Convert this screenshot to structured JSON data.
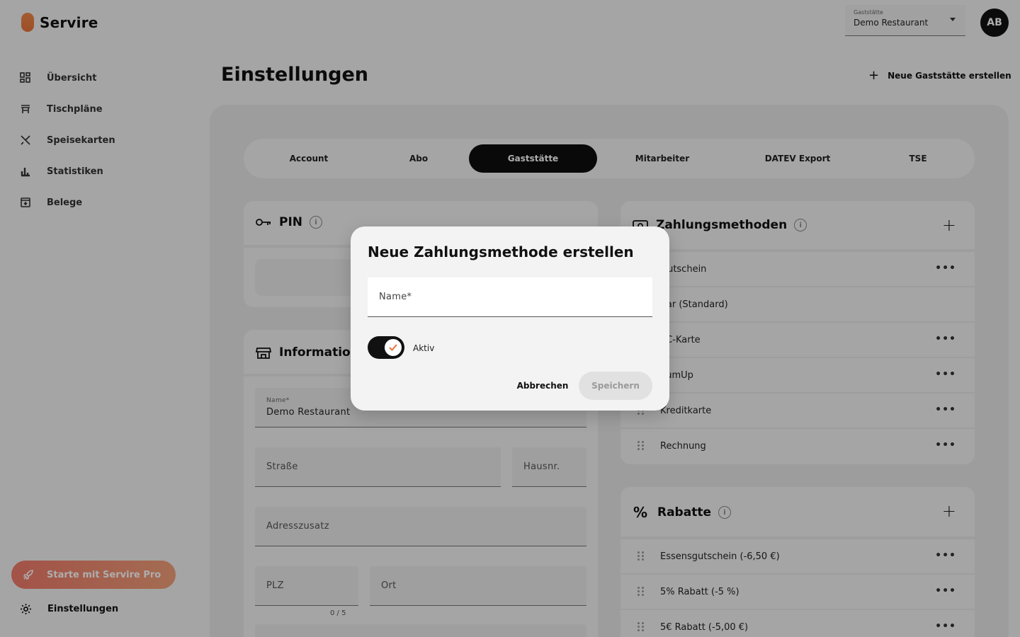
{
  "app": {
    "name": "Servire"
  },
  "sidebar": {
    "items": [
      {
        "label": "Übersicht",
        "icon": "dashboard-icon"
      },
      {
        "label": "Tischpläne",
        "icon": "table-icon"
      },
      {
        "label": "Speisekarten",
        "icon": "utensils-icon"
      },
      {
        "label": "Statistiken",
        "icon": "bar-chart-icon"
      },
      {
        "label": "Belege",
        "icon": "receipt-icon"
      }
    ],
    "pro_label": "Starte mit Servire Pro",
    "settings_label": "Einstellungen"
  },
  "header": {
    "venue_select_label": "Gaststätte",
    "venue_select_value": "Demo Restaurant",
    "avatar_initials": "AB",
    "page_title": "Einstellungen",
    "new_venue_label": "Neue Gaststätte erstellen"
  },
  "tabs": [
    {
      "label": "Account"
    },
    {
      "label": "Abo"
    },
    {
      "label": "Gaststätte",
      "active": true
    },
    {
      "label": "Mitarbeiter"
    },
    {
      "label": "DATEV Export"
    },
    {
      "label": "TSE"
    }
  ],
  "pin_card": {
    "title": "PIN"
  },
  "info_card": {
    "title": "Informationen",
    "name_label": "Name*",
    "name_value": "Demo Restaurant",
    "street_placeholder": "Straße",
    "house_placeholder": "Hausnr.",
    "address_extra_placeholder": "Adresszusatz",
    "zip_placeholder": "PLZ",
    "zip_counter": "0 / 5",
    "city_placeholder": "Ort"
  },
  "payment_card": {
    "title": "Zahlungsmethoden",
    "items": [
      {
        "label": "Gutschein",
        "has_menu": true
      },
      {
        "label": "Bar (Standard)",
        "has_menu": false
      },
      {
        "label": "EC-Karte",
        "has_menu": true
      },
      {
        "label": "SumUp",
        "has_menu": true
      },
      {
        "label": "Kreditkarte",
        "has_menu": true
      },
      {
        "label": "Rechnung",
        "has_menu": true
      }
    ]
  },
  "discount_card": {
    "title": "Rabatte",
    "items": [
      {
        "label": "Essensgutschein (-6,50 €)"
      },
      {
        "label": "5% Rabatt (-5 %)"
      },
      {
        "label": "5€ Rabatt (-5,00 €)"
      }
    ]
  },
  "dialog": {
    "title": "Neue Zahlungsmethode erstellen",
    "name_placeholder": "Name*",
    "active_label": "Aktiv",
    "active": true,
    "cancel_label": "Abbrechen",
    "save_label": "Speichern"
  },
  "colors": {
    "accent": "#e8743b",
    "tab_active_bg": "#0e0e0e",
    "panel_bg": "#e9e8e8"
  }
}
